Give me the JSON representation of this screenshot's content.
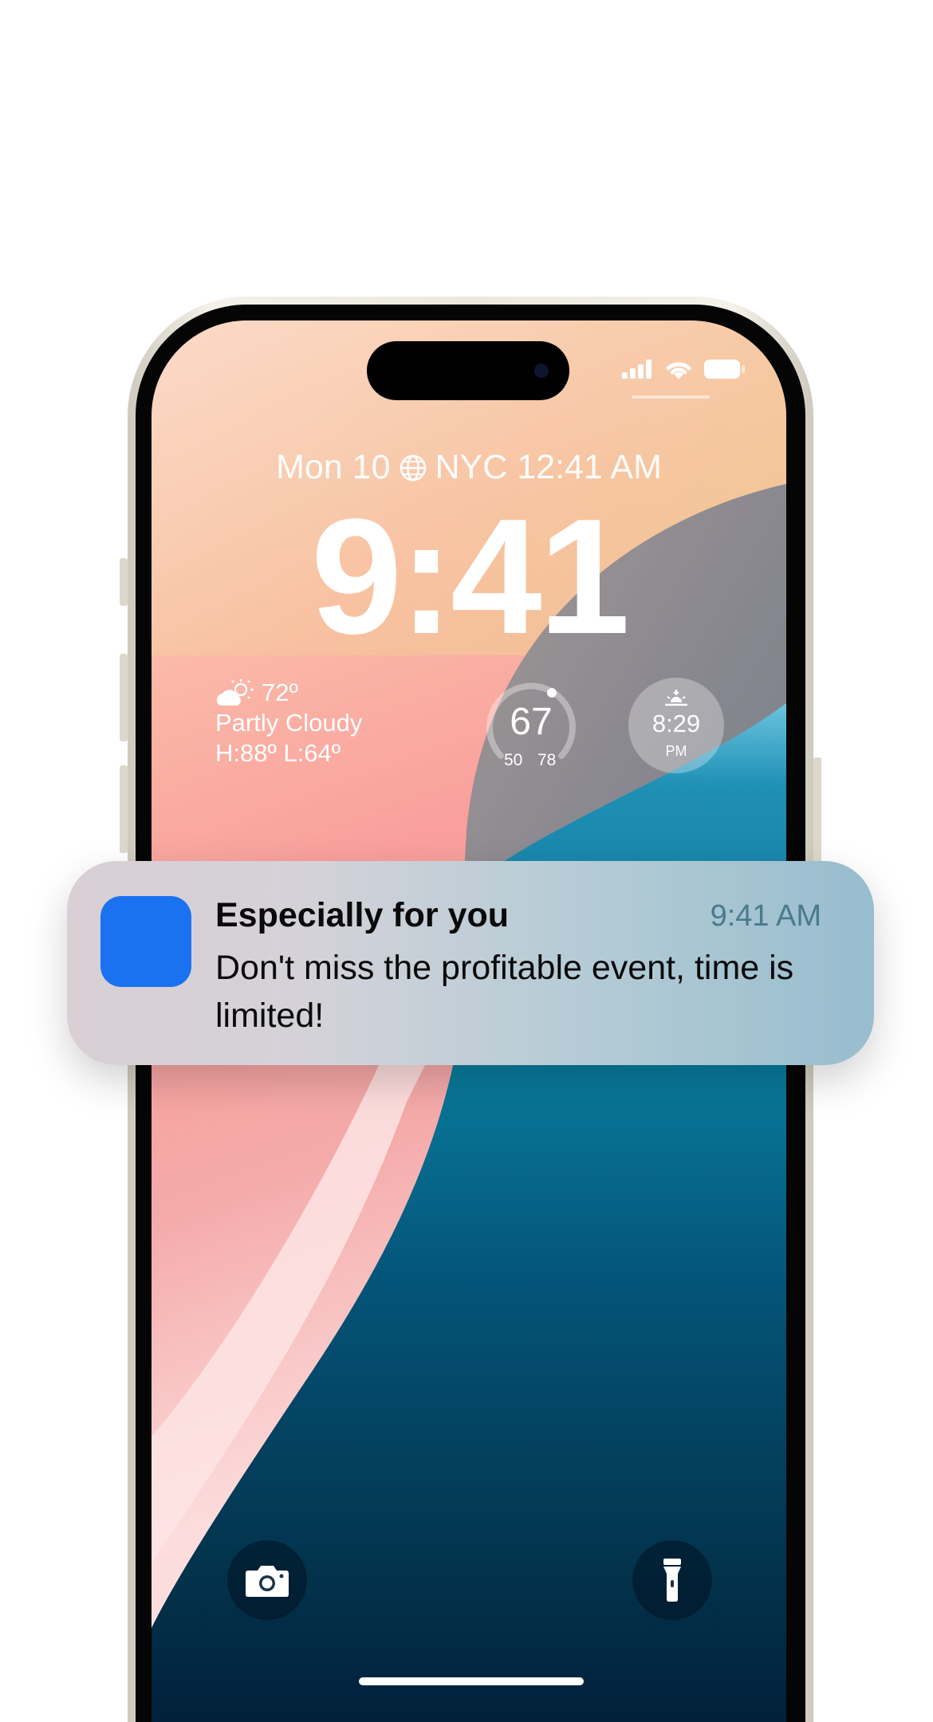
{
  "lock_screen": {
    "date": "Mon 10",
    "world_clock": "NYC 12:41 AM",
    "time": "9:41",
    "weather": {
      "temperature": "72º",
      "condition": "Partly Cloudy",
      "high_low": "H:88º L:64º"
    },
    "gauge": {
      "value": "67",
      "low": "50",
      "high": "78"
    },
    "sunset": {
      "time": "8:29",
      "period": "PM"
    }
  },
  "notification": {
    "title": "Especially for you",
    "time": "9:41 AM",
    "body": "Don't miss the profitable event, time is limited!",
    "app_icon_color": "#1a72f0"
  },
  "icons": {
    "status": [
      "cellular-signal-icon",
      "wifi-icon",
      "battery-icon"
    ],
    "date_line": "globe-icon",
    "weather": "partly-cloudy-icon",
    "sunset": "sunset-icon",
    "quick_actions": [
      "camera-icon",
      "flashlight-icon"
    ]
  }
}
